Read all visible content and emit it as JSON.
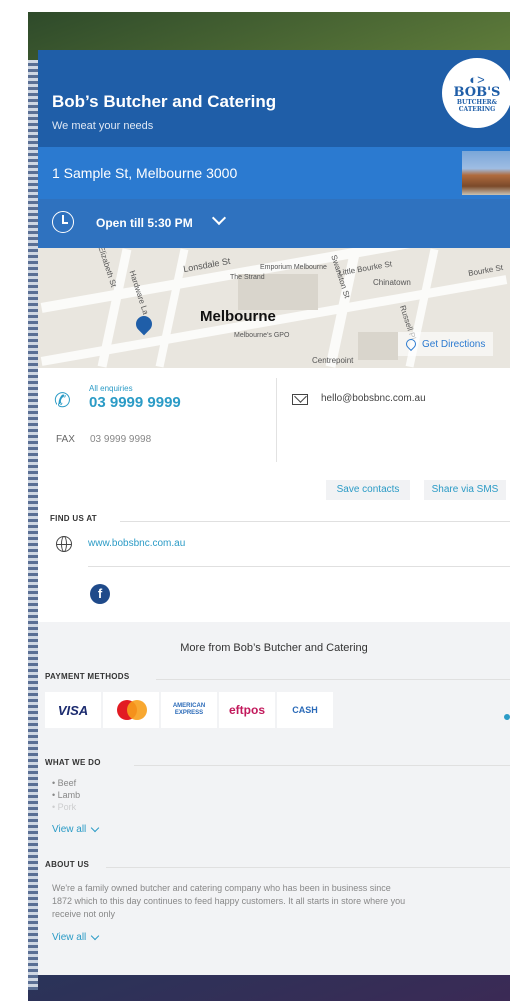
{
  "business": {
    "name": "Bob’s Butcher and Catering",
    "tagline": "We meat your needs",
    "logo_main": "BOB'S",
    "logo_sub_1": "BUTCHER&",
    "logo_sub_2": "CATERING",
    "address": "1 Sample St, Melbourne 3000",
    "hours": "Open till 5:30 PM"
  },
  "map": {
    "city": "Melbourne",
    "labels": [
      "Lonsdale St",
      "Little Bourke St",
      "Chinatown",
      "Bourke St",
      "Hardware La",
      "Elizabeth St",
      "Centrepoint",
      "Emporium Melbourne",
      "The Strand",
      "Melbourne's GPO",
      "Swanston St",
      "Russell Pl"
    ],
    "directions": "Get Directions"
  },
  "contact": {
    "enquiries_label": "All enquiries",
    "phone": "03 9999 9999",
    "fax_label": "FAX",
    "fax": "03 9999 9998",
    "email": "hello@bobsbnc.com.au"
  },
  "actions": {
    "save": "Save contacts",
    "share": "Share via SMS"
  },
  "find_us": {
    "label": "FIND US AT",
    "website": "www.bobsbnc.com.au",
    "facebook_glyph": "f"
  },
  "more": {
    "title": "More from Bob’s Butcher and Catering",
    "payment_label": "PAYMENT METHODS",
    "payments": {
      "visa": "VISA",
      "amex_1": "AMERICAN",
      "amex_2": "EXPRESS",
      "eftpos": "eftpos",
      "cash": "CASH"
    },
    "what_label": "WHAT WE DO",
    "services": [
      "Beef",
      "Lamb",
      "Pork"
    ],
    "view_all": "View all",
    "about_label": "ABOUT US",
    "about_text": "We're a family owned butcher and catering company who has been in business since 1872 which to this day continues to feed happy customers. It all starts in store where you receive not only"
  },
  "colors": {
    "header": "#1f5ea8",
    "accent": "#2b9bc6",
    "address_bar": "#2b7ad0"
  }
}
